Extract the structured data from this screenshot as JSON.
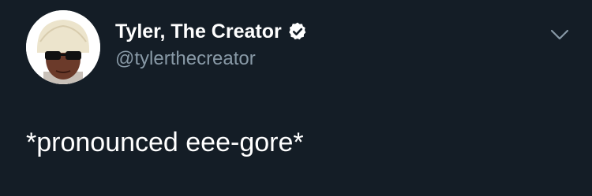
{
  "tweet": {
    "author": {
      "name": "Tyler, The Creator",
      "handle": "@tylerthecreator",
      "verified": true,
      "avatar_icon": "profile-photo"
    },
    "menu_icon": "chevron-down-icon",
    "text": "*pronounced eee-gore*"
  },
  "colors": {
    "background": "#141d26",
    "name": "#ffffff",
    "handle": "#8899a6",
    "text": "#ffffff",
    "verified_badge": "#ffffff"
  }
}
